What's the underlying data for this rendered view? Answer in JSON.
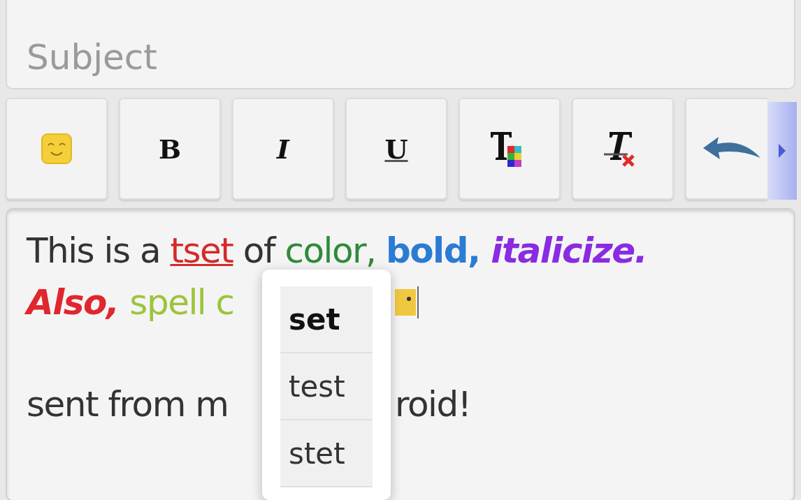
{
  "subject": {
    "placeholder": "Subject"
  },
  "toolbar": [
    {
      "kind": "emoji"
    },
    {
      "kind": "bold",
      "label": "B"
    },
    {
      "kind": "italic",
      "label": "I"
    },
    {
      "kind": "underline",
      "label": "U"
    },
    {
      "kind": "text-color"
    },
    {
      "kind": "clear-format"
    },
    {
      "kind": "undo"
    }
  ],
  "body": {
    "paragraphs": [
      {
        "lines": [
          [
            {
              "kind": "text",
              "text": "This is a ",
              "color": "#333333",
              "bold": false,
              "italic": false,
              "misspelled": false
            },
            {
              "kind": "text",
              "text": "tset",
              "color": "#d42a2a",
              "bold": false,
              "italic": false,
              "misspelled": true
            },
            {
              "kind": "text",
              "text": " of ",
              "color": "#333333",
              "bold": false,
              "italic": false,
              "misspelled": false
            },
            {
              "kind": "text",
              "text": "color, ",
              "color": "#2f8a3a",
              "bold": false,
              "italic": false,
              "misspelled": false
            },
            {
              "kind": "text",
              "text": "bold, ",
              "color": "#2b7bd4",
              "bold": true,
              "italic": false,
              "misspelled": false
            },
            {
              "kind": "text",
              "text": "italicize.",
              "color": "#8a2be2",
              "bold": true,
              "italic": true,
              "misspelled": false
            }
          ],
          [
            {
              "kind": "text",
              "text": "Also, ",
              "color": "#e0262e",
              "bold": true,
              "italic": true,
              "misspelled": false
            },
            {
              "kind": "text",
              "text": "spell c",
              "color": "#9cc43c",
              "bold": false,
              "italic": false,
              "misspelled": false
            },
            {
              "kind": "covered"
            },
            {
              "kind": "emoticon"
            }
          ]
        ]
      },
      {
        "lines": [
          [
            {
              "kind": "text",
              "text": "sent from m",
              "color": "#333333",
              "bold": false,
              "italic": false,
              "misspelled": false
            },
            {
              "kind": "covered"
            },
            {
              "kind": "text",
              "text": "roid!",
              "color": "#333333",
              "bold": false,
              "italic": false,
              "misspelled": false
            }
          ]
        ]
      }
    ]
  },
  "suggestions": [
    {
      "text": "set",
      "selected": true
    },
    {
      "text": "test",
      "selected": false
    },
    {
      "text": "stet",
      "selected": false
    }
  ]
}
